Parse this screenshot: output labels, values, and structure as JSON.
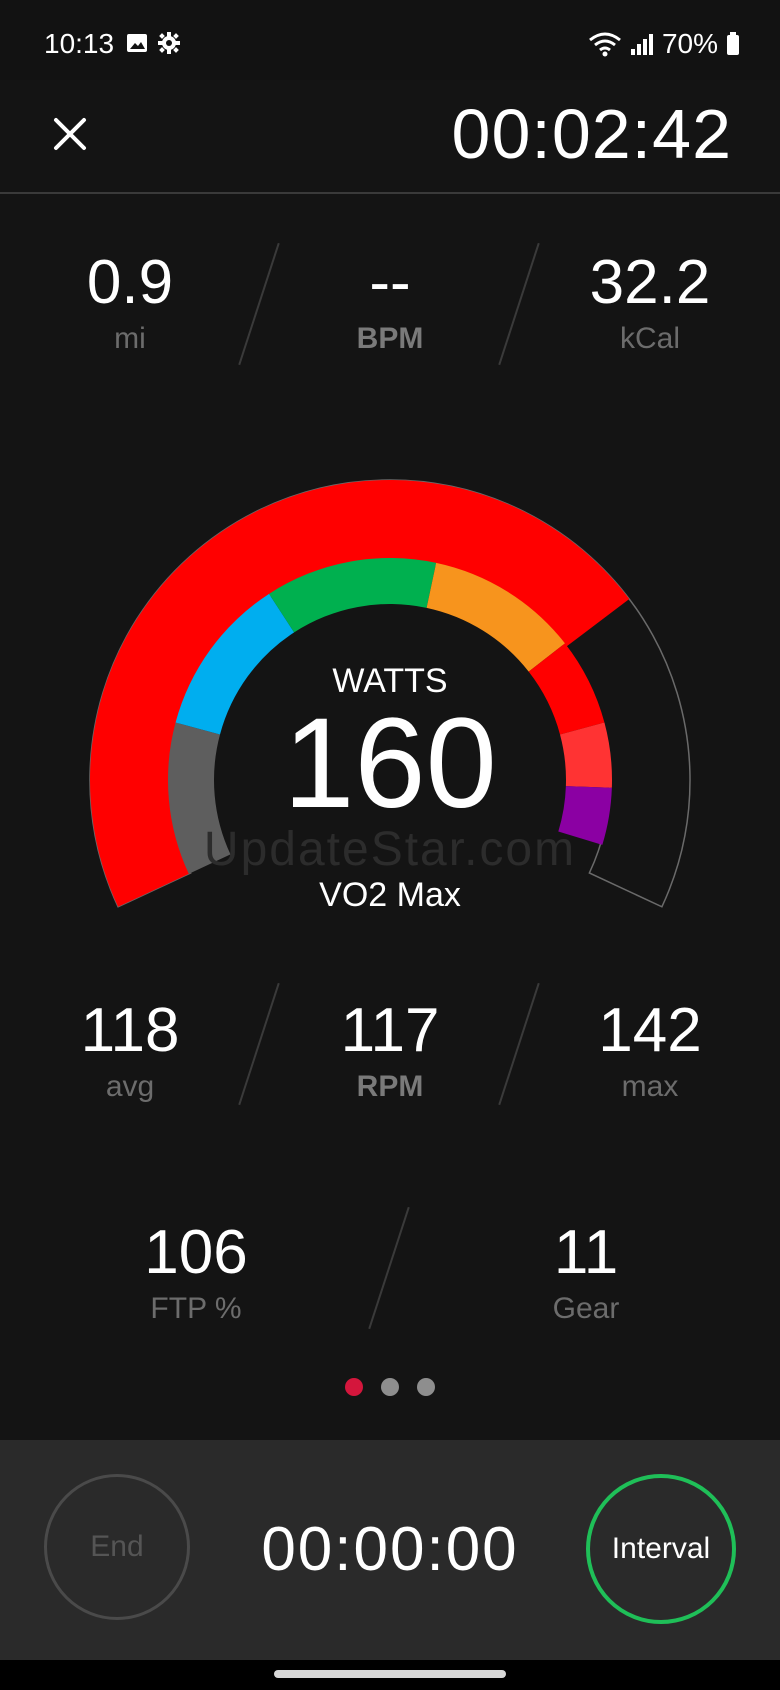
{
  "status_bar": {
    "time": "10:13",
    "icons": [
      "image-icon",
      "gear-icon"
    ],
    "right_icons": [
      "wifi-icon",
      "signal-icon"
    ],
    "battery": "70%"
  },
  "header": {
    "close_icon": "close-icon",
    "elapsed_time": "00:02:42"
  },
  "top_metrics": [
    {
      "value": "0.9",
      "label": "mi"
    },
    {
      "value": "--",
      "label": "BPM"
    },
    {
      "value": "32.2",
      "label": "kCal"
    }
  ],
  "gauge": {
    "label": "WATTS",
    "value": "160",
    "zone": "VO2 Max",
    "outer_fill_fraction": 0.73,
    "colors": {
      "outer": "#ff0000",
      "zone1": "#5e5e5e",
      "zone2": "#00aeef",
      "zone3": "#00b04f",
      "zone4": "#f7941d",
      "zone5": "#ff0000",
      "zone6": "#ff3333",
      "zone7": "#8b00a3"
    }
  },
  "watermark": "UpdateStar.com",
  "middle_metrics": [
    {
      "value": "118",
      "label": "avg"
    },
    {
      "value": "117",
      "label": "RPM"
    },
    {
      "value": "142",
      "label": "max"
    }
  ],
  "lower_metrics": [
    {
      "value": "106",
      "label": "FTP %"
    },
    {
      "value": "11",
      "label": "Gear"
    }
  ],
  "pager": {
    "count": 3,
    "active": 0
  },
  "bottom": {
    "end_label": "End",
    "interval_time": "00:00:00",
    "interval_label": "Interval"
  },
  "theme": {
    "background": "#141414",
    "accent_green": "#1fbf58",
    "pager_active": "#d4163c"
  }
}
